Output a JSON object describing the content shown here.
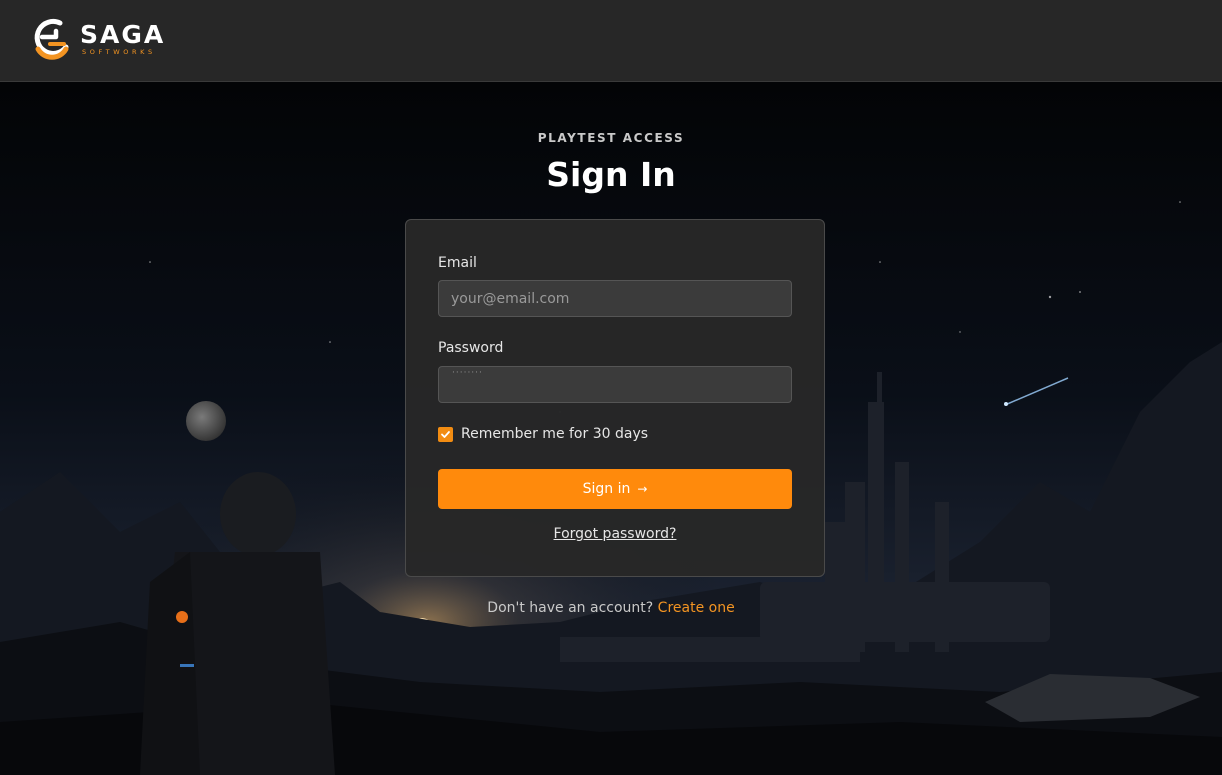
{
  "header": {
    "brand": "SAGA",
    "brand_sub": "SOFTWORKS",
    "accent": "#f39422"
  },
  "page": {
    "eyebrow": "PLAYTEST ACCESS",
    "title": "Sign In"
  },
  "form": {
    "email_label": "Email",
    "email_placeholder": "your@email.com",
    "email_value": "",
    "password_label": "Password",
    "password_mask": "········",
    "remember_label": "Remember me for 30 days",
    "remember_checked": true,
    "submit_label": "Sign in",
    "submit_icon": "arrow-right-icon",
    "forgot_label": "Forgot password?"
  },
  "footer": {
    "prompt": "Don't have an account?",
    "link": "Create one"
  },
  "colors": {
    "header_bg": "#272727",
    "card_bg": "#282828",
    "primary_button": "#ff8a0c"
  }
}
